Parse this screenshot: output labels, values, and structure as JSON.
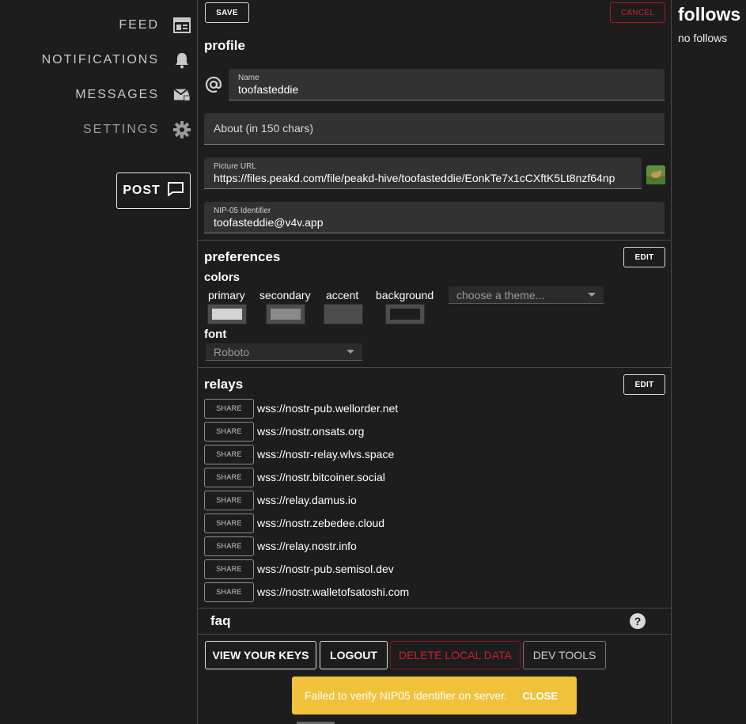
{
  "nav": {
    "items": [
      {
        "label": "FEED",
        "icon": "feed-icon"
      },
      {
        "label": "NOTIFICATIONS",
        "icon": "bell-icon"
      },
      {
        "label": "MESSAGES",
        "icon": "mail-lock-icon"
      },
      {
        "label": "SETTINGS",
        "icon": "gear-icon"
      }
    ],
    "post_label": "POST"
  },
  "toolbar": {
    "save_label": "SAVE",
    "cancel_label": "CANCEL"
  },
  "profile": {
    "title": "profile",
    "name_label": "Name",
    "name_value": "toofasteddie",
    "about_placeholder": "About (in 150 chars)",
    "picture_label": "Picture URL",
    "picture_value": "https://files.peakd.com/file/peakd-hive/toofasteddie/EonkTe7x1cCXftK5Lt8nzf64np",
    "nip05_label": "NIP-05 Identifier",
    "nip05_value": "toofasteddie@v4v.app"
  },
  "preferences": {
    "title": "preferences",
    "edit_label": "EDIT",
    "colors_label": "colors",
    "color_names": [
      "primary",
      "secondary",
      "accent",
      "background"
    ],
    "color_values": [
      "#d4d4d4",
      "#8a8a8a",
      "#4d4d4d",
      "#1d1d1d"
    ],
    "theme_placeholder": "choose a theme...",
    "font_label": "font",
    "font_value": "Roboto"
  },
  "relays": {
    "title": "relays",
    "edit_label": "EDIT",
    "share_label": "SHARE",
    "urls": [
      "wss://nostr-pub.wellorder.net",
      "wss://nostr.onsats.org",
      "wss://nostr-relay.wlvs.space",
      "wss://nostr.bitcoiner.social",
      "wss://relay.damus.io",
      "wss://nostr.zebedee.cloud",
      "wss://relay.nostr.info",
      "wss://nostr-pub.semisol.dev",
      "wss://nostr.walletofsatoshi.com"
    ]
  },
  "faq": {
    "title": "faq",
    "help_icon": "help-circle-icon"
  },
  "actions": {
    "view_keys": "VIEW YOUR KEYS",
    "logout": "LOGOUT",
    "delete_local": "DELETE LOCAL DATA",
    "dev_tools": "DEV TOOLS"
  },
  "toast": {
    "message": "Failed to verify NIP05 identifier on server.",
    "close_label": "CLOSE"
  },
  "follows": {
    "title": "follows",
    "empty": "no follows"
  },
  "colors": {
    "danger": "#c9202f",
    "warning": "#f0c23b",
    "bg": "#1d1d1d"
  }
}
